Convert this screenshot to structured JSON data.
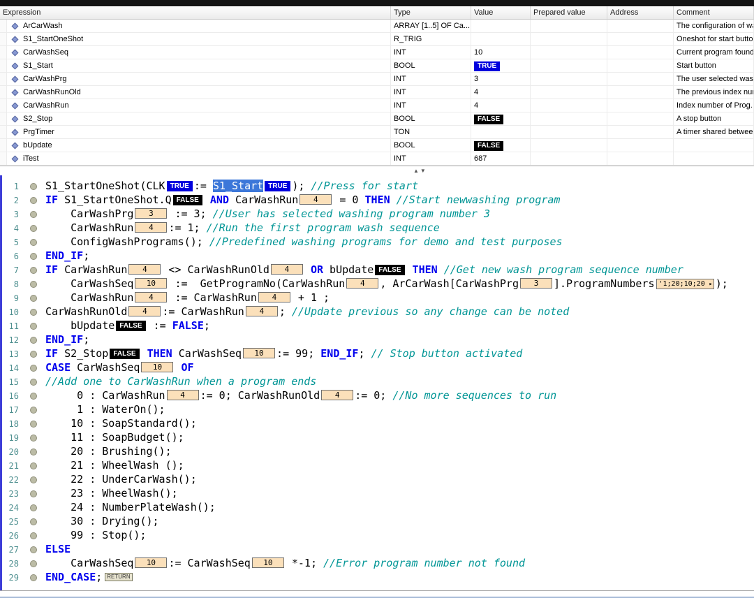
{
  "colors": {
    "true_badge": "#0000dd",
    "false_badge": "#000000",
    "keyword": "#0000ee",
    "comment": "#009595",
    "inline_value_bg": "#fbe0ba",
    "editor_left_edge": "#3d3dd8"
  },
  "splitter": {
    "up_icon": "▲",
    "down_icon": "▼"
  },
  "watch_table": {
    "columns": [
      "Expression",
      "Type",
      "Value",
      "Prepared value",
      "Address",
      "Comment"
    ],
    "rows": [
      {
        "expression": "ArCarWash",
        "type": "ARRAY [1..5] OF Ca...",
        "value": "",
        "value_kind": "none",
        "prepared": "",
        "address": "",
        "comment": "The configuration of wash programs"
      },
      {
        "expression": "S1_StartOneShot",
        "type": "R_TRIG",
        "value": "",
        "value_kind": "none",
        "prepared": "",
        "address": "",
        "comment": "Oneshot for start button"
      },
      {
        "expression": "CarWashSeq",
        "type": "INT",
        "value": "10",
        "value_kind": "int",
        "prepared": "",
        "address": "",
        "comment": "Current program found"
      },
      {
        "expression": "S1_Start",
        "type": "BOOL",
        "value": "TRUE",
        "value_kind": "true",
        "prepared": "",
        "address": "",
        "comment": "Start button"
      },
      {
        "expression": "CarWashPrg",
        "type": "INT",
        "value": "3",
        "value_kind": "int",
        "prepared": "",
        "address": "",
        "comment": "The user selected wash program"
      },
      {
        "expression": "CarWashRunOld",
        "type": "INT",
        "value": "4",
        "value_kind": "int",
        "prepared": "",
        "address": "",
        "comment": "The previous index number"
      },
      {
        "expression": "CarWashRun",
        "type": "INT",
        "value": "4",
        "value_kind": "int",
        "prepared": "",
        "address": "",
        "comment": "Index number of Prog."
      },
      {
        "expression": "S2_Stop",
        "type": "BOOL",
        "value": "FALSE",
        "value_kind": "false",
        "prepared": "",
        "address": "",
        "comment": "A stop button"
      },
      {
        "expression": "PrgTimer",
        "type": "TON",
        "value": "",
        "value_kind": "none",
        "prepared": "",
        "address": "",
        "comment": "A timer shared between"
      },
      {
        "expression": "bUpdate",
        "type": "BOOL",
        "value": "FALSE",
        "value_kind": "false",
        "prepared": "",
        "address": "",
        "comment": ""
      },
      {
        "expression": "iTest",
        "type": "INT",
        "value": "687",
        "value_kind": "int",
        "prepared": "",
        "address": "",
        "comment": ""
      }
    ]
  },
  "editor": {
    "lines": [
      {
        "no": "1",
        "segments": [
          {
            "t": "S1_StartOneShot(CLK",
            "c": "code"
          },
          {
            "box": "TRUE",
            "k": "true"
          },
          {
            "t": ":= ",
            "c": "code"
          },
          {
            "t": "S1_Start",
            "c": "sel"
          },
          {
            "box": "TRUE",
            "k": "true"
          },
          {
            "t": "); ",
            "c": "code"
          },
          {
            "t": "//Press for start",
            "c": "cmt"
          }
        ]
      },
      {
        "no": "2",
        "segments": [
          {
            "t": "IF",
            "c": "kw"
          },
          {
            "t": " S1_StartOneShot.Q",
            "c": "code"
          },
          {
            "box": "FALSE",
            "k": "false"
          },
          {
            "t": " ",
            "c": "code"
          },
          {
            "t": "AND",
            "c": "kw"
          },
          {
            "t": " CarWashRun",
            "c": "code"
          },
          {
            "box": "4",
            "k": "int"
          },
          {
            "t": " = 0 ",
            "c": "code"
          },
          {
            "t": "THEN",
            "c": "kw"
          },
          {
            "t": " ",
            "c": "code"
          },
          {
            "t": "//Start newwashing program",
            "c": "cmt"
          }
        ]
      },
      {
        "no": "3",
        "segments": [
          {
            "t": "    CarWashPrg",
            "c": "code"
          },
          {
            "box": "3",
            "k": "int"
          },
          {
            "t": " := 3; ",
            "c": "code"
          },
          {
            "t": "//User has selected washing program number 3",
            "c": "cmt"
          }
        ]
      },
      {
        "no": "4",
        "segments": [
          {
            "t": "    CarWashRun",
            "c": "code"
          },
          {
            "box": "4",
            "k": "int"
          },
          {
            "t": ":= 1; ",
            "c": "code"
          },
          {
            "t": "//Run the first program wash sequence",
            "c": "cmt"
          }
        ]
      },
      {
        "no": "5",
        "segments": [
          {
            "t": "    ConfigWashPrograms(); ",
            "c": "code"
          },
          {
            "t": "//Predefined washing programs for demo and test purposes",
            "c": "cmt"
          }
        ]
      },
      {
        "no": "6",
        "segments": [
          {
            "t": "END_IF",
            "c": "kw"
          },
          {
            "t": ";",
            "c": "code"
          }
        ]
      },
      {
        "no": "7",
        "segments": [
          {
            "t": "IF",
            "c": "kw"
          },
          {
            "t": " CarWashRun",
            "c": "code"
          },
          {
            "box": "4",
            "k": "int"
          },
          {
            "t": " <> CarWashRunOld",
            "c": "code"
          },
          {
            "box": "4",
            "k": "int"
          },
          {
            "t": " ",
            "c": "code"
          },
          {
            "t": "OR",
            "c": "kw"
          },
          {
            "t": " bUpdate",
            "c": "code"
          },
          {
            "box": "FALSE",
            "k": "false"
          },
          {
            "t": " ",
            "c": "code"
          },
          {
            "t": "THEN",
            "c": "kw"
          },
          {
            "t": " ",
            "c": "code"
          },
          {
            "t": "//Get new wash program sequence number",
            "c": "cmt"
          }
        ]
      },
      {
        "no": "8",
        "segments": [
          {
            "t": "    CarWashSeq",
            "c": "code"
          },
          {
            "box": "10",
            "k": "int"
          },
          {
            "t": " :=  GetProgramNo(CarWashRun",
            "c": "code"
          },
          {
            "box": "4",
            "k": "int"
          },
          {
            "t": ", ArCarWash[CarWashPrg",
            "c": "code"
          },
          {
            "box": "3",
            "k": "int"
          },
          {
            "t": "].ProgramNumbers",
            "c": "code"
          },
          {
            "box": "'1;20;10;20",
            "k": "str"
          },
          {
            "t": ");",
            "c": "code"
          }
        ]
      },
      {
        "no": "9",
        "segments": [
          {
            "t": "    CarWashRun",
            "c": "code"
          },
          {
            "box": "4",
            "k": "int"
          },
          {
            "t": " := CarWashRun",
            "c": "code"
          },
          {
            "box": "4",
            "k": "int"
          },
          {
            "t": " + 1 ;",
            "c": "code"
          }
        ]
      },
      {
        "no": "10",
        "segments": [
          {
            "t": "CarWashRunOld",
            "c": "code"
          },
          {
            "box": "4",
            "k": "int"
          },
          {
            "t": ":= CarWashRun",
            "c": "code"
          },
          {
            "box": "4",
            "k": "int"
          },
          {
            "t": "; ",
            "c": "code"
          },
          {
            "t": "//Update previous so any change can be noted",
            "c": "cmt"
          }
        ]
      },
      {
        "no": "11",
        "segments": [
          {
            "t": "    bUpdate",
            "c": "code"
          },
          {
            "box": "FALSE",
            "k": "false"
          },
          {
            "t": " := ",
            "c": "code"
          },
          {
            "t": "FALSE",
            "c": "kw"
          },
          {
            "t": ";",
            "c": "code"
          }
        ]
      },
      {
        "no": "12",
        "segments": [
          {
            "t": "END_IF",
            "c": "kw"
          },
          {
            "t": ";",
            "c": "code"
          }
        ]
      },
      {
        "no": "13",
        "segments": [
          {
            "t": "IF",
            "c": "kw"
          },
          {
            "t": " S2_Stop",
            "c": "code"
          },
          {
            "box": "FALSE",
            "k": "false"
          },
          {
            "t": " ",
            "c": "code"
          },
          {
            "t": "THEN",
            "c": "kw"
          },
          {
            "t": " CarWashSeq",
            "c": "code"
          },
          {
            "box": "10",
            "k": "int"
          },
          {
            "t": ":= 99; ",
            "c": "code"
          },
          {
            "t": "END_IF",
            "c": "kw"
          },
          {
            "t": "; ",
            "c": "code"
          },
          {
            "t": "// Stop button activated",
            "c": "cmt"
          }
        ]
      },
      {
        "no": "14",
        "segments": [
          {
            "t": "CASE",
            "c": "kw"
          },
          {
            "t": " CarWashSeq",
            "c": "code"
          },
          {
            "box": "10",
            "k": "int"
          },
          {
            "t": " ",
            "c": "code"
          },
          {
            "t": "OF",
            "c": "kw"
          }
        ]
      },
      {
        "no": "15",
        "segments": [
          {
            "t": "//Add one to CarWashRun when a program ends",
            "c": "cmt"
          }
        ]
      },
      {
        "no": "16",
        "segments": [
          {
            "t": "     0 : CarWashRun",
            "c": "code"
          },
          {
            "box": "4",
            "k": "int"
          },
          {
            "t": ":= 0; CarWashRunOld",
            "c": "code"
          },
          {
            "box": "4",
            "k": "int"
          },
          {
            "t": ":= 0; ",
            "c": "code"
          },
          {
            "t": "//No more sequences to run",
            "c": "cmt"
          }
        ]
      },
      {
        "no": "17",
        "segments": [
          {
            "t": "     1 : WaterOn();",
            "c": "code"
          }
        ]
      },
      {
        "no": "18",
        "segments": [
          {
            "t": "    10 : SoapStandard();",
            "c": "code"
          }
        ]
      },
      {
        "no": "19",
        "segments": [
          {
            "t": "    11 : SoapBudget();",
            "c": "code"
          }
        ]
      },
      {
        "no": "20",
        "segments": [
          {
            "t": "    20 : Brushing();",
            "c": "code"
          }
        ]
      },
      {
        "no": "21",
        "segments": [
          {
            "t": "    21 : WheelWash ();",
            "c": "code"
          }
        ]
      },
      {
        "no": "22",
        "segments": [
          {
            "t": "    22 : UnderCarWash();",
            "c": "code"
          }
        ]
      },
      {
        "no": "23",
        "segments": [
          {
            "t": "    23 : WheelWash();",
            "c": "code"
          }
        ]
      },
      {
        "no": "24",
        "segments": [
          {
            "t": "    24 : NumberPlateWash();",
            "c": "code"
          }
        ]
      },
      {
        "no": "25",
        "segments": [
          {
            "t": "    30 : Drying();",
            "c": "code"
          }
        ]
      },
      {
        "no": "26",
        "segments": [
          {
            "t": "    99 : Stop();",
            "c": "code"
          }
        ]
      },
      {
        "no": "27",
        "segments": [
          {
            "t": "ELSE",
            "c": "kw"
          }
        ]
      },
      {
        "no": "28",
        "segments": [
          {
            "t": "    CarWashSeq",
            "c": "code"
          },
          {
            "box": "10",
            "k": "int"
          },
          {
            "t": ":= CarWashSeq",
            "c": "code"
          },
          {
            "box": "10",
            "k": "int"
          },
          {
            "t": " *-1; ",
            "c": "code"
          },
          {
            "t": "//Error program number not found",
            "c": "cmt"
          }
        ]
      },
      {
        "no": "29",
        "segments": [
          {
            "t": "END_CASE",
            "c": "kw"
          },
          {
            "t": ";",
            "c": "code"
          },
          {
            "box": "RETURN",
            "k": "ret"
          }
        ]
      }
    ]
  }
}
